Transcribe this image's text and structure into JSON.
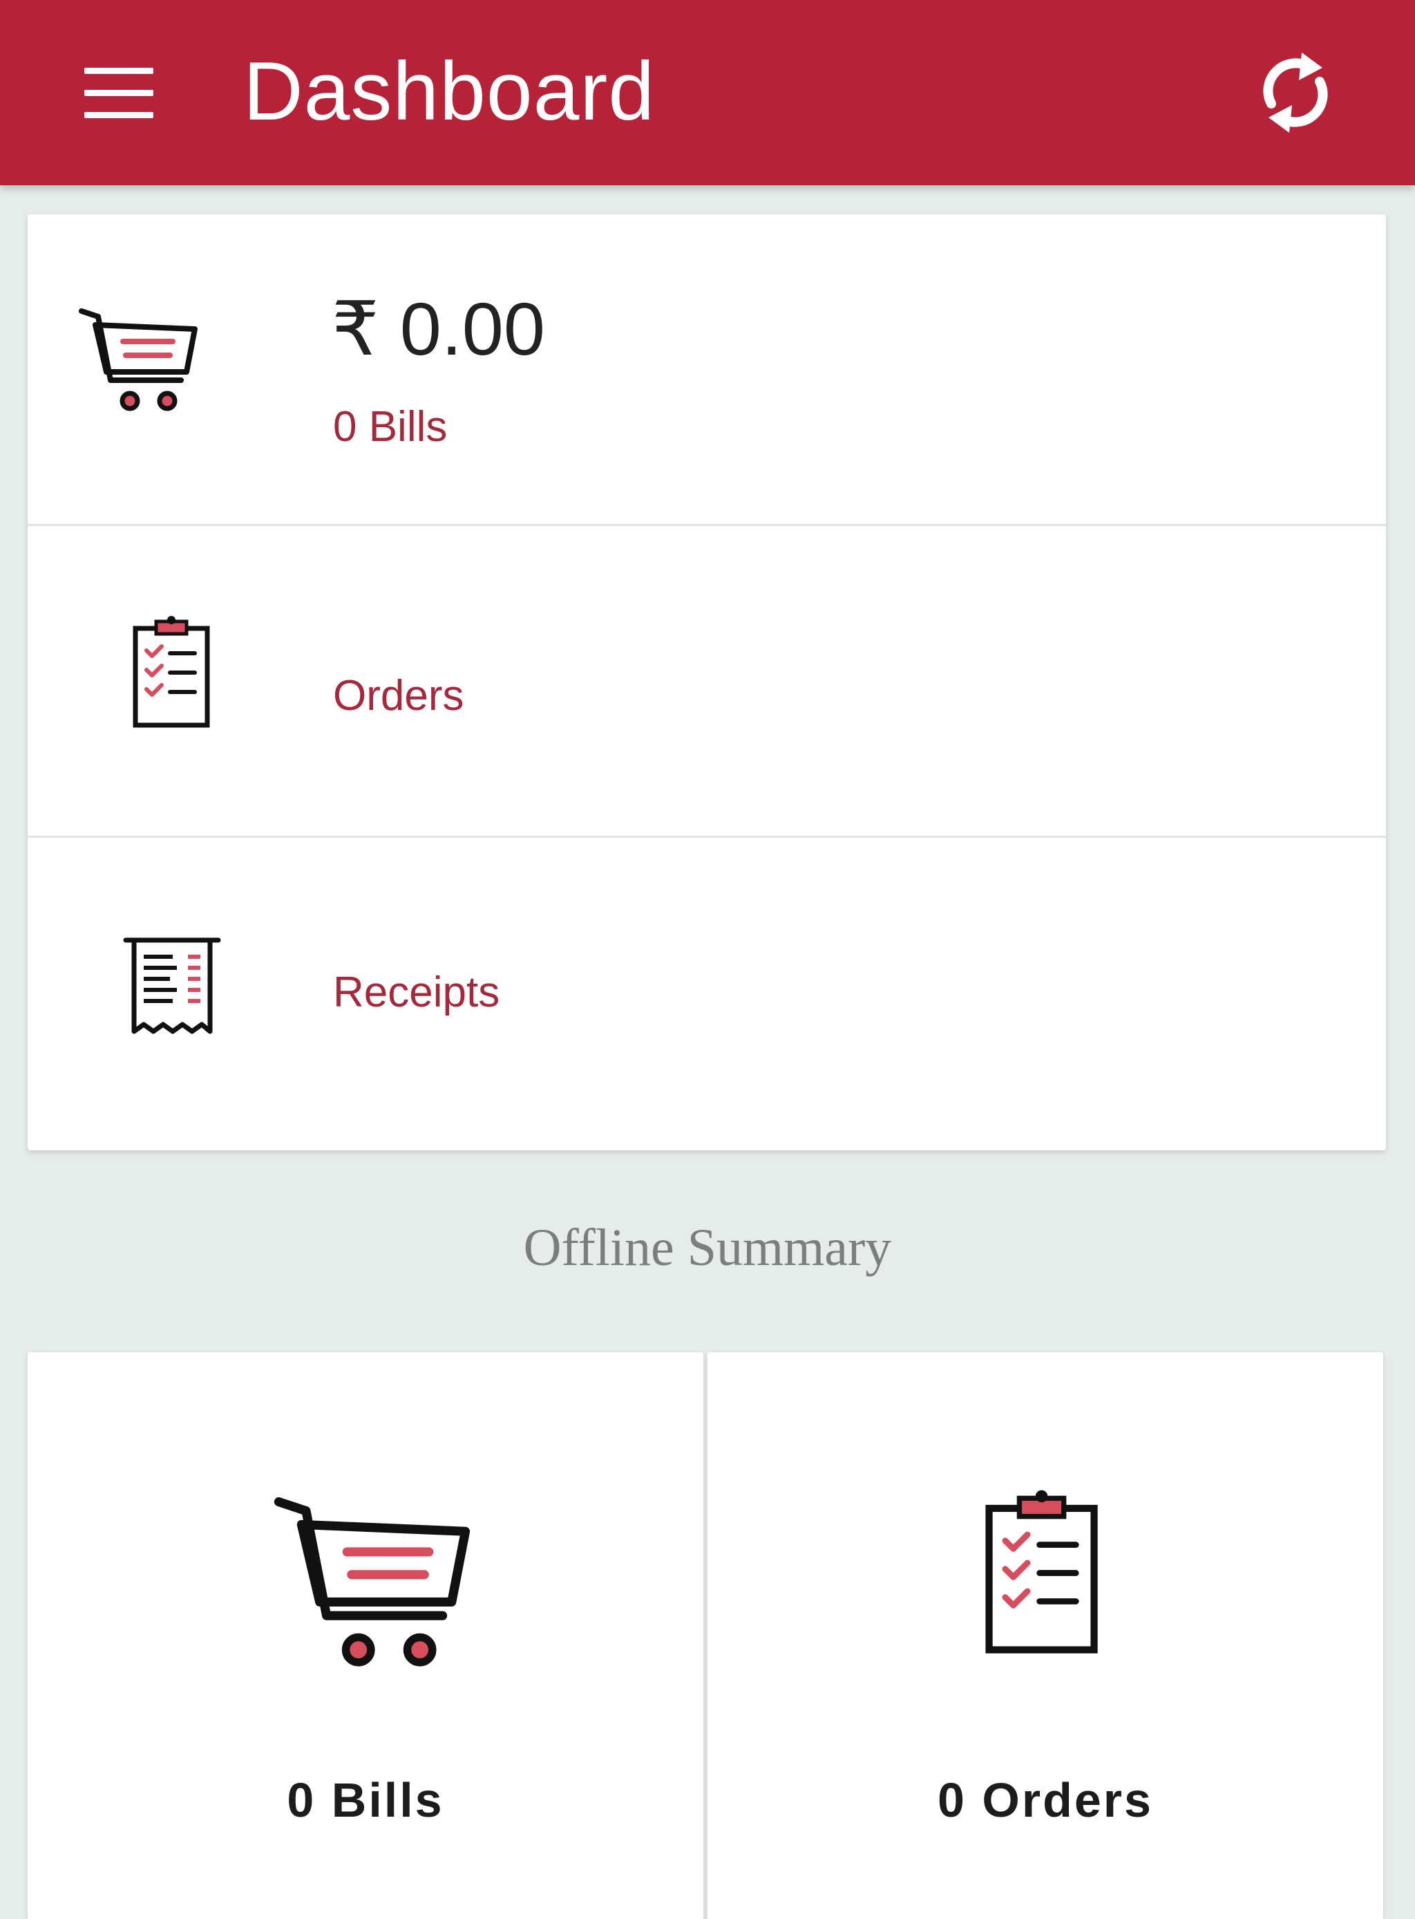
{
  "header": {
    "title": "Dashboard",
    "menu_icon": "hamburger-menu-icon",
    "refresh_icon": "refresh-icon"
  },
  "summary": {
    "amount": "₹ 0.00",
    "bills_count": "0 Bills",
    "cart_icon": "shopping-cart-icon",
    "orders_label": "Orders",
    "orders_icon": "clipboard-checklist-icon",
    "receipts_label": "Receipts",
    "receipts_icon": "receipt-icon"
  },
  "offline": {
    "heading": "Offline Summary",
    "bills_label": "0 Bills",
    "orders_label": "0 Orders"
  },
  "colors": {
    "brand": "#b62237",
    "accent_text": "#a5283b",
    "icon_accent": "#d64d5d",
    "background": "#e6ece9",
    "card": "#ffffff"
  }
}
